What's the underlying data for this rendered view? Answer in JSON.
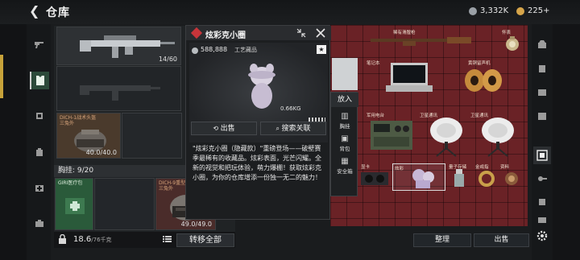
{
  "header": {
    "title": "仓库",
    "currency_1": "3,332K",
    "currency_2": "225+",
    "currency_1_color": "#9aa0a6",
    "currency_2_color": "#d6a54a"
  },
  "left_rail": {
    "items": [
      "rifle-icon",
      "armor-icon",
      "helmet-icon",
      "backpack-icon",
      "medkit-icon",
      "briefcase-icon"
    ]
  },
  "left_panel": {
    "weapon_count": "14/60",
    "helmet_label_line1": "DICH-1战术头盔",
    "helmet_label_line2": "三兔外",
    "helmet_durability": "40.0/40.0",
    "stash_title": "胸挂: 9/20",
    "green_item_label": "GIRI医疗包",
    "second_helmet_label_line1": "DICH-9重型头盔",
    "second_helmet_label_line2": "三兔外",
    "second_helmet_durability": "49.0/49.0",
    "weight": "18.6",
    "weight_max": "/76千克",
    "transfer_all": "转移全部"
  },
  "popup": {
    "title": "炫彩克小圈",
    "price": "588,888",
    "category": "工艺藏品",
    "weight": "0.66KG",
    "sell_label": "出售",
    "search_label": "搜索关联",
    "description": "\"炫彩克小圈（隐藏款）\"重磅登场——破壁赛季最稀有的收藏品。炫彩表面，光芒闪耀。全新的视觉和把玩体验，萌力爆棚！获取炫彩克小圈，为你的仓库增添一份独一无二的魅力！",
    "accent_color": "#c8353a"
  },
  "put_in": {
    "title": "放入",
    "items": [
      {
        "label": "胸挂",
        "icon": "vest-icon"
      },
      {
        "label": "背包",
        "icon": "backpack-icon"
      },
      {
        "label": "安全箱",
        "icon": "safebox-icon"
      }
    ]
  },
  "right_panel": {
    "labels": {
      "rifle": "稀有滑膛枪",
      "jar": "怀表",
      "laptop": "笔记本",
      "gramophone": "黄铜留声机",
      "radio": "军用电台",
      "satellite_1": "卫星通讯",
      "satellite_2": "卫星通讯",
      "gpu": "显卡",
      "figure": "炫彩",
      "usb": "量子存储",
      "ring": "金戒指",
      "other": "资料"
    },
    "panel_color": "#6a2226"
  },
  "right_rail": {
    "items": [
      "shop-icon",
      "armor-icon",
      "case-icon",
      "chest-icon",
      "key-icon",
      "chip-icon",
      "keycard-icon",
      "lock-icon"
    ]
  },
  "bottom_right": {
    "sort_label": "整理",
    "sell_label": "出售",
    "settings": "gear-icon"
  }
}
